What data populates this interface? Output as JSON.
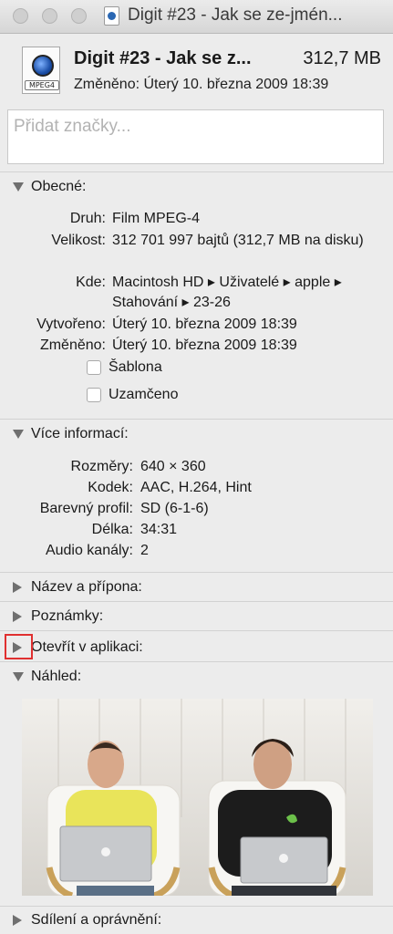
{
  "window": {
    "title": "Digit #23 - Jak se ze-jmén..."
  },
  "header": {
    "file_name": "Digit #23 - Jak se z...",
    "file_size": "312,7 MB",
    "modified": "Změněno: Úterý 10. března 2009 18:39",
    "icon_label": "MPEG4"
  },
  "tags": {
    "placeholder": "Přidat značky..."
  },
  "general": {
    "title": "Obecné:",
    "rows": [
      {
        "key": "Druh:",
        "value": "Film MPEG-4"
      },
      {
        "key": "Velikost:",
        "value": "312 701 997 bajtů (312,7 MB na disku)"
      },
      {
        "key": "Kde:",
        "value": "Macintosh HD ▸ Uživatelé ▸ apple ▸ Stahování ▸ 23-26"
      },
      {
        "key": "Vytvořeno:",
        "value": "Úterý 10. března 2009 18:39"
      },
      {
        "key": "Změněno:",
        "value": "Úterý 10. března 2009 18:39"
      }
    ],
    "stationery": "Šablona",
    "locked": "Uzamčeno"
  },
  "more_info": {
    "title": "Více informací:",
    "rows": [
      {
        "key": "Rozměry:",
        "value": "640 × 360"
      },
      {
        "key": "Kodek:",
        "value": "AAC, H.264, Hint"
      },
      {
        "key": "Barevný profil:",
        "value": "SD (6-1-6)"
      },
      {
        "key": "Délka:",
        "value": "34:31"
      },
      {
        "key": "Audio kanály:",
        "value": "2"
      }
    ]
  },
  "sections": {
    "name_ext": "Název a přípona:",
    "comments": "Poznámky:",
    "open_with": "Otevřít v aplikaci:",
    "preview": "Náhled:",
    "sharing": "Sdílení a oprávnění:"
  },
  "colors": {
    "background": "#ececec",
    "focus_ring": "#e03030"
  }
}
